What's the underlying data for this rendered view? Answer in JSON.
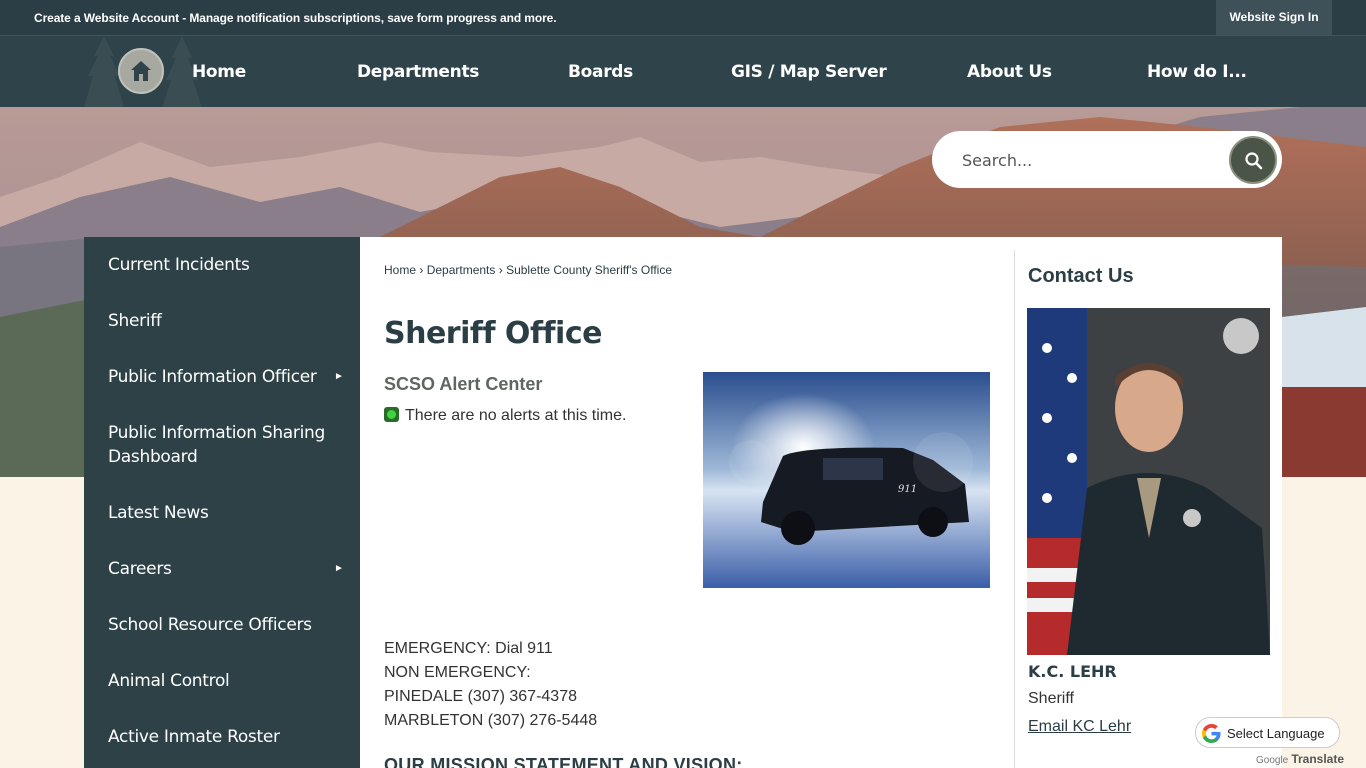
{
  "topbar": {
    "account_link": "Create a Website Account",
    "account_desc": " - Manage notification subscriptions, save form progress and more.",
    "sign_in": "Website Sign In"
  },
  "nav": {
    "items": [
      "Home",
      "Departments",
      "Boards",
      "GIS / Map Server",
      "About Us",
      "How do I..."
    ]
  },
  "search": {
    "placeholder": "Search..."
  },
  "sidebar": {
    "items": [
      {
        "label": "Current Incidents",
        "has_submenu": false
      },
      {
        "label": "Sheriff",
        "has_submenu": false
      },
      {
        "label": "Public Information Officer",
        "has_submenu": true
      },
      {
        "label": "Public Information Sharing Dashboard",
        "has_submenu": false
      },
      {
        "label": "Latest News",
        "has_submenu": false
      },
      {
        "label": "Careers",
        "has_submenu": true
      },
      {
        "label": "School Resource Officers",
        "has_submenu": false
      },
      {
        "label": "Animal Control",
        "has_submenu": false
      },
      {
        "label": "Active Inmate Roster",
        "has_submenu": false
      }
    ]
  },
  "breadcrumb": [
    "Home",
    "Departments",
    "Sublette County Sheriff's Office"
  ],
  "main": {
    "title": "Sheriff Office",
    "alert_heading": "SCSO Alert Center",
    "alert_text": "There are no alerts at this time.",
    "emergency": "EMERGENCY: Dial 911",
    "non_emergency": "NON EMERGENCY:",
    "pinedale": "PINEDALE (307) 367-4378",
    "marbleton": "MARBLETON (307) 276-5448",
    "mission_heading": "OUR MISSION STATEMENT AND VISION:"
  },
  "contact": {
    "heading": "Contact Us",
    "name": "K.C. LEHR",
    "title": "Sheriff",
    "email_link": "Email KC Lehr"
  },
  "translate": {
    "label": "Select Language",
    "powered_google": "Google",
    "powered_translate": "Translate"
  },
  "colors": {
    "dark_teal": "#2b3e45",
    "sidebar": "#2d4147",
    "page_bg": "#fbf3e6",
    "alert_green": "#3ed43e"
  }
}
